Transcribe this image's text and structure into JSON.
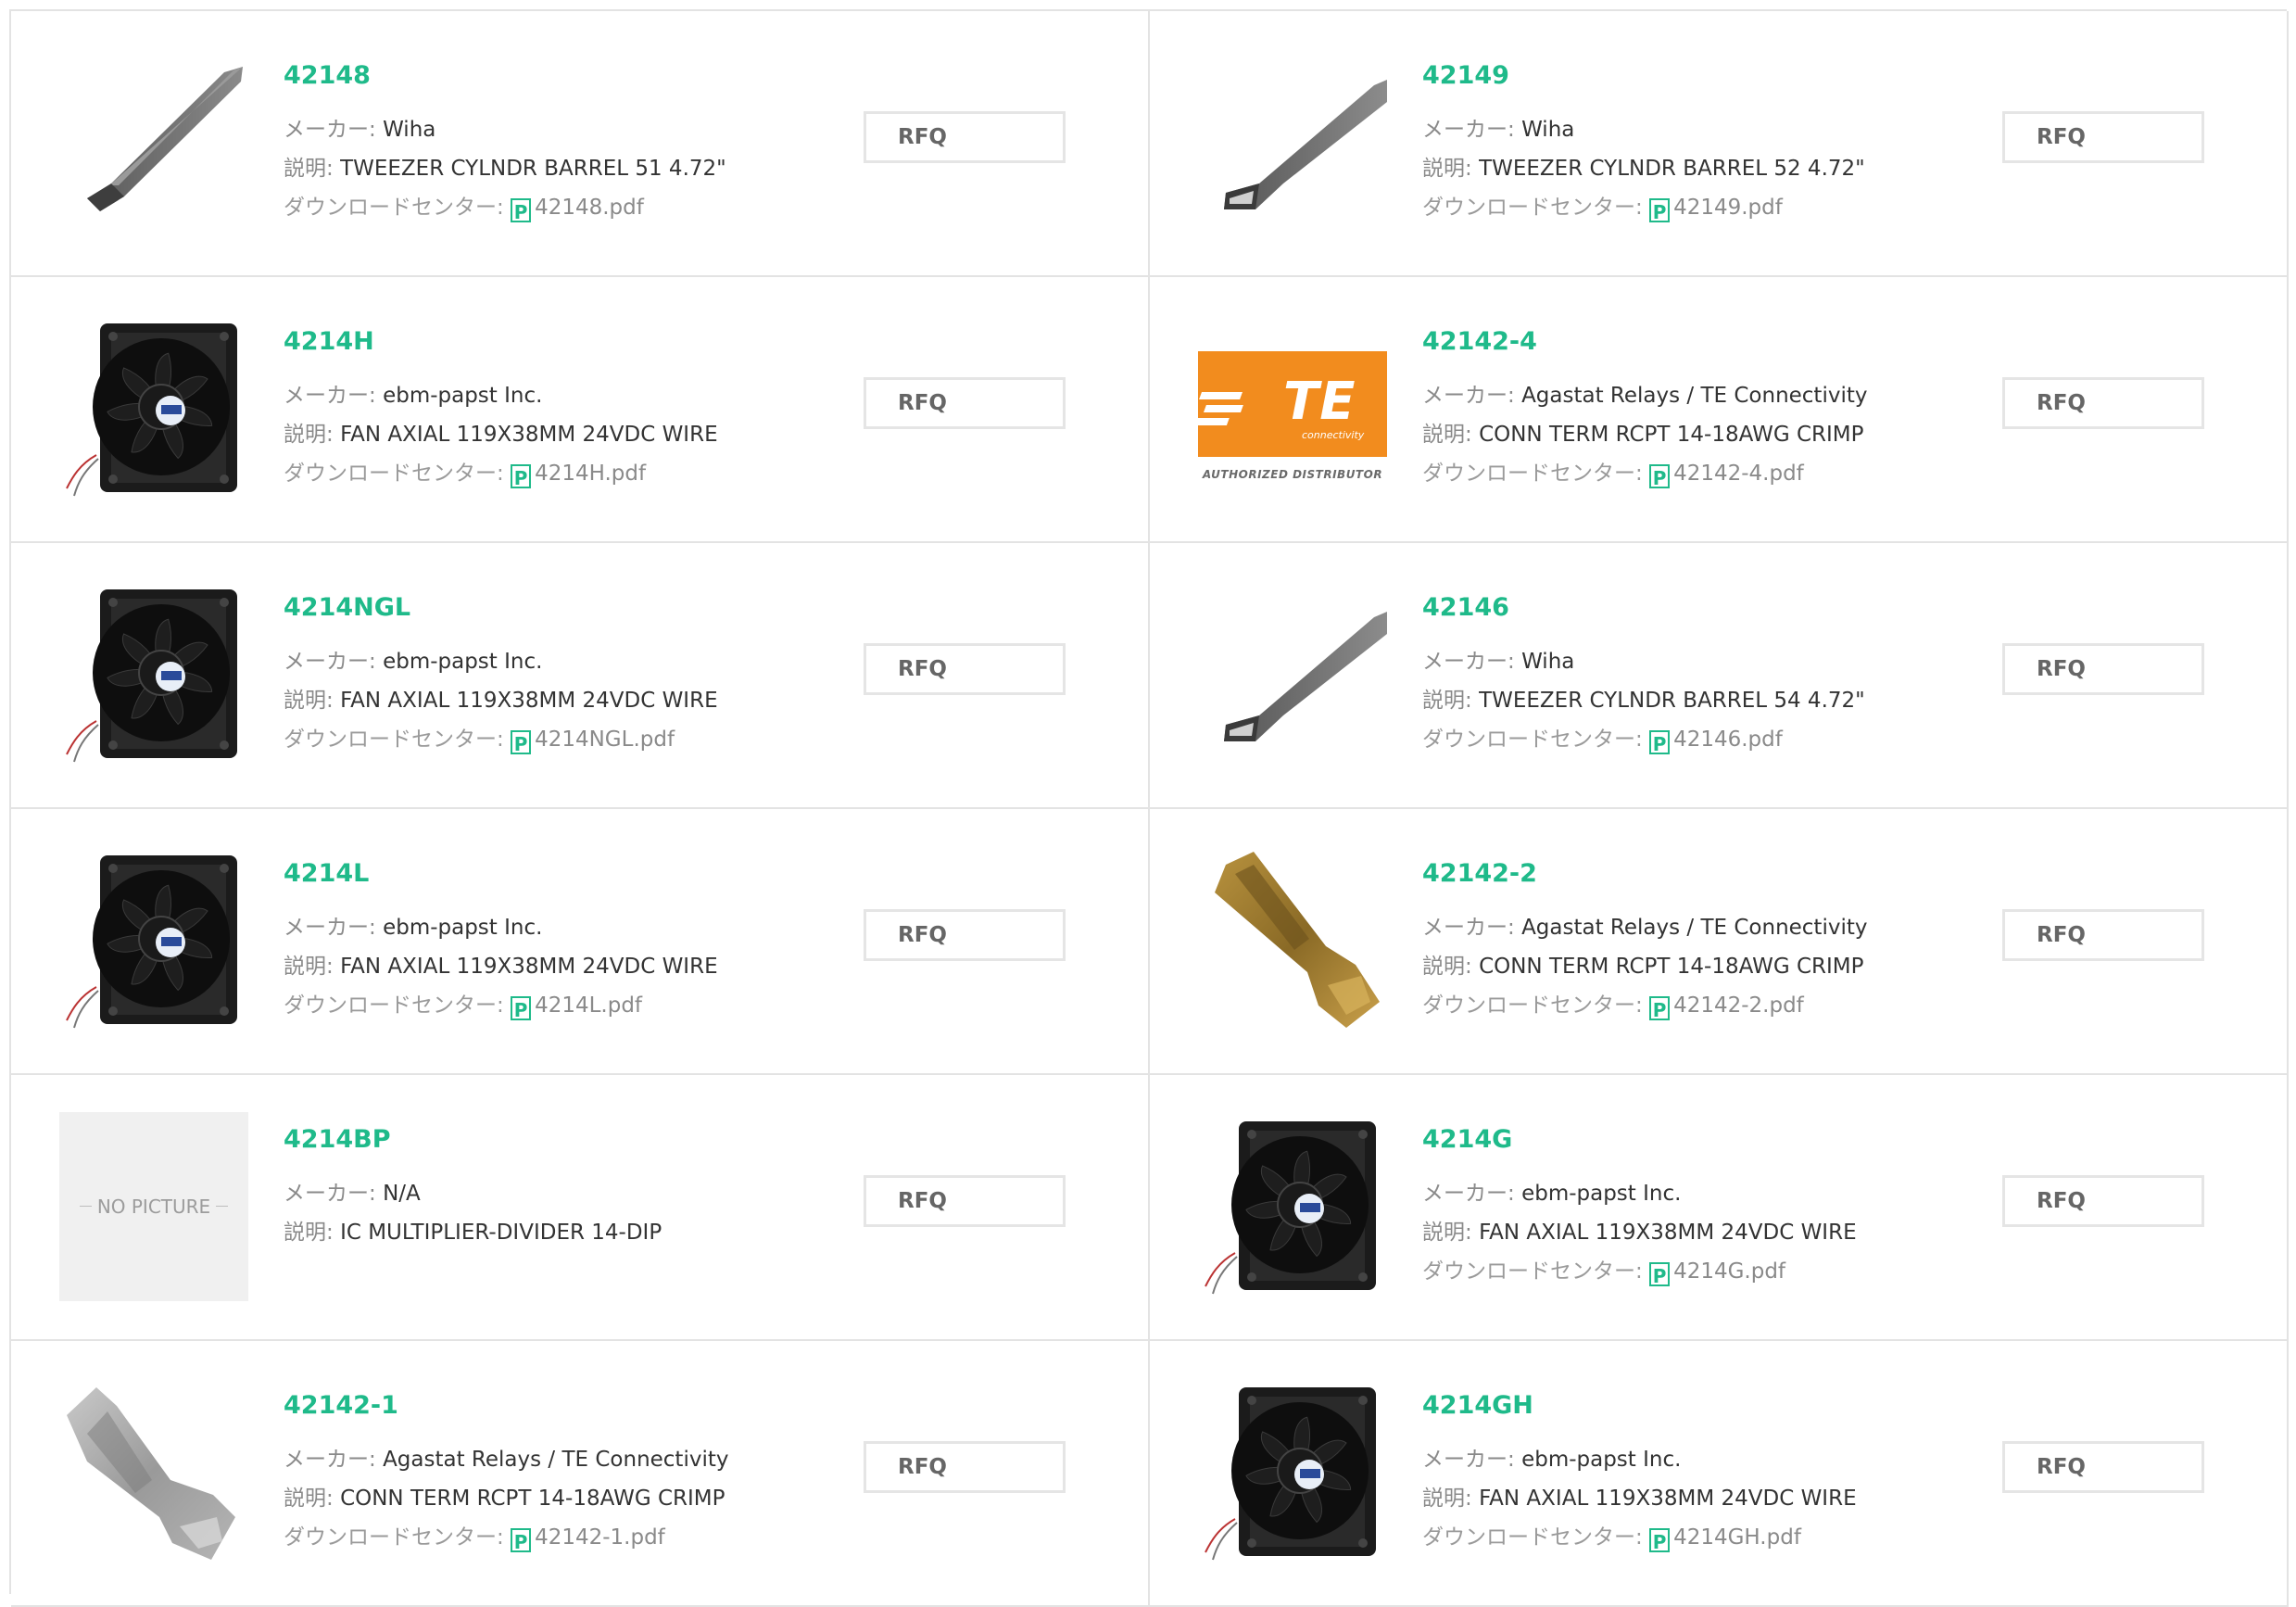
{
  "labels": {
    "maker": "メーカー: ",
    "desc": "説明: ",
    "download": "ダウンロードセンター: ",
    "pdf_icon": "P",
    "rfq": "RFQ",
    "no_picture": "NO PICTURE"
  },
  "colors": {
    "accent": "#1fba8a",
    "border": "#e3e3e3",
    "te_orange": "#f28c1e"
  },
  "items": [
    {
      "part": "42148",
      "maker": "Wiha",
      "desc": "TWEEZER CYLNDR BARREL 51 4.72\"",
      "pdf": "42148.pdf",
      "image": "tweezer-icon"
    },
    {
      "part": "42149",
      "maker": "Wiha",
      "desc": "TWEEZER CYLNDR BARREL 52 4.72\"",
      "pdf": "42149.pdf",
      "image": "tweezer-icon"
    },
    {
      "part": "4214H",
      "maker": "ebm-papst Inc.",
      "desc": "FAN AXIAL 119X38MM 24VDC WIRE",
      "pdf": "4214H.pdf",
      "image": "fan-icon"
    },
    {
      "part": "42142-4",
      "maker": "Agastat Relays / TE Connectivity",
      "desc": "CONN TERM RCPT 14-18AWG CRIMP",
      "pdf": "42142-4.pdf",
      "image": "te-logo",
      "logo_text": "TE",
      "logo_sub": "connectivity",
      "logo_caption": "AUTHORIZED DISTRIBUTOR"
    },
    {
      "part": "4214NGL",
      "maker": "ebm-papst Inc.",
      "desc": "FAN AXIAL 119X38MM 24VDC WIRE",
      "pdf": "4214NGL.pdf",
      "image": "fan-icon"
    },
    {
      "part": "42146",
      "maker": "Wiha",
      "desc": "TWEEZER CYLNDR BARREL 54 4.72\"",
      "pdf": "42146.pdf",
      "image": "tweezer-icon"
    },
    {
      "part": "4214L",
      "maker": "ebm-papst Inc.",
      "desc": "FAN AXIAL 119X38MM 24VDC WIRE",
      "pdf": "4214L.pdf",
      "image": "fan-icon"
    },
    {
      "part": "42142-2",
      "maker": "Agastat Relays / TE Connectivity",
      "desc": "CONN TERM RCPT 14-18AWG CRIMP",
      "pdf": "42142-2.pdf",
      "image": "brass-terminal-icon"
    },
    {
      "part": "4214BP",
      "maker": "N/A",
      "desc": "IC MULTIPLIER-DIVIDER 14-DIP",
      "pdf": "",
      "image": "no-picture"
    },
    {
      "part": "4214G",
      "maker": "ebm-papst Inc.",
      "desc": "FAN AXIAL 119X38MM 24VDC WIRE",
      "pdf": "4214G.pdf",
      "image": "fan-icon"
    },
    {
      "part": "42142-1",
      "maker": "Agastat Relays / TE Connectivity",
      "desc": "CONN TERM RCPT 14-18AWG CRIMP",
      "pdf": "42142-1.pdf",
      "image": "silver-terminal-icon"
    },
    {
      "part": "4214GH",
      "maker": "ebm-papst Inc.",
      "desc": "FAN AXIAL 119X38MM 24VDC WIRE",
      "pdf": "4214GH.pdf",
      "image": "fan-icon"
    }
  ]
}
